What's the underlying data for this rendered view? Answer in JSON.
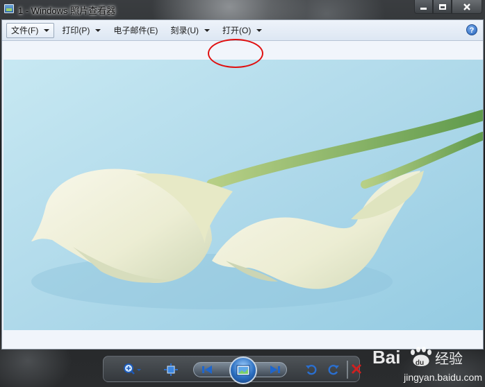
{
  "window": {
    "title": "1 - Windows 照片查看器",
    "caption_buttons": [
      "minimize",
      "maximize",
      "close"
    ]
  },
  "menubar": {
    "items": [
      {
        "label": "文件(F)",
        "has_dropdown": true,
        "active": true
      },
      {
        "label": "打印(P)",
        "has_dropdown": true,
        "active": false
      },
      {
        "label": "电子邮件(E)",
        "has_dropdown": false,
        "active": false
      },
      {
        "label": "刻录(U)",
        "has_dropdown": true,
        "active": false
      },
      {
        "label": "打开(O)",
        "has_dropdown": true,
        "active": false
      }
    ],
    "help_glyph": "?"
  },
  "photo": {
    "subject": "calla lilies",
    "background_color": "#bfe3ef"
  },
  "controls": {
    "icons": [
      "zoom-icon",
      "actual-size-icon",
      "previous-icon",
      "slideshow-icon",
      "next-icon",
      "rotate-left-icon",
      "rotate-right-icon",
      "delete-icon"
    ]
  },
  "watermark": {
    "logo": "Bai du 经验",
    "url": "jingyan.baidu.com"
  },
  "colors": {
    "annotation": "#e01010",
    "delete": "#d02020"
  }
}
